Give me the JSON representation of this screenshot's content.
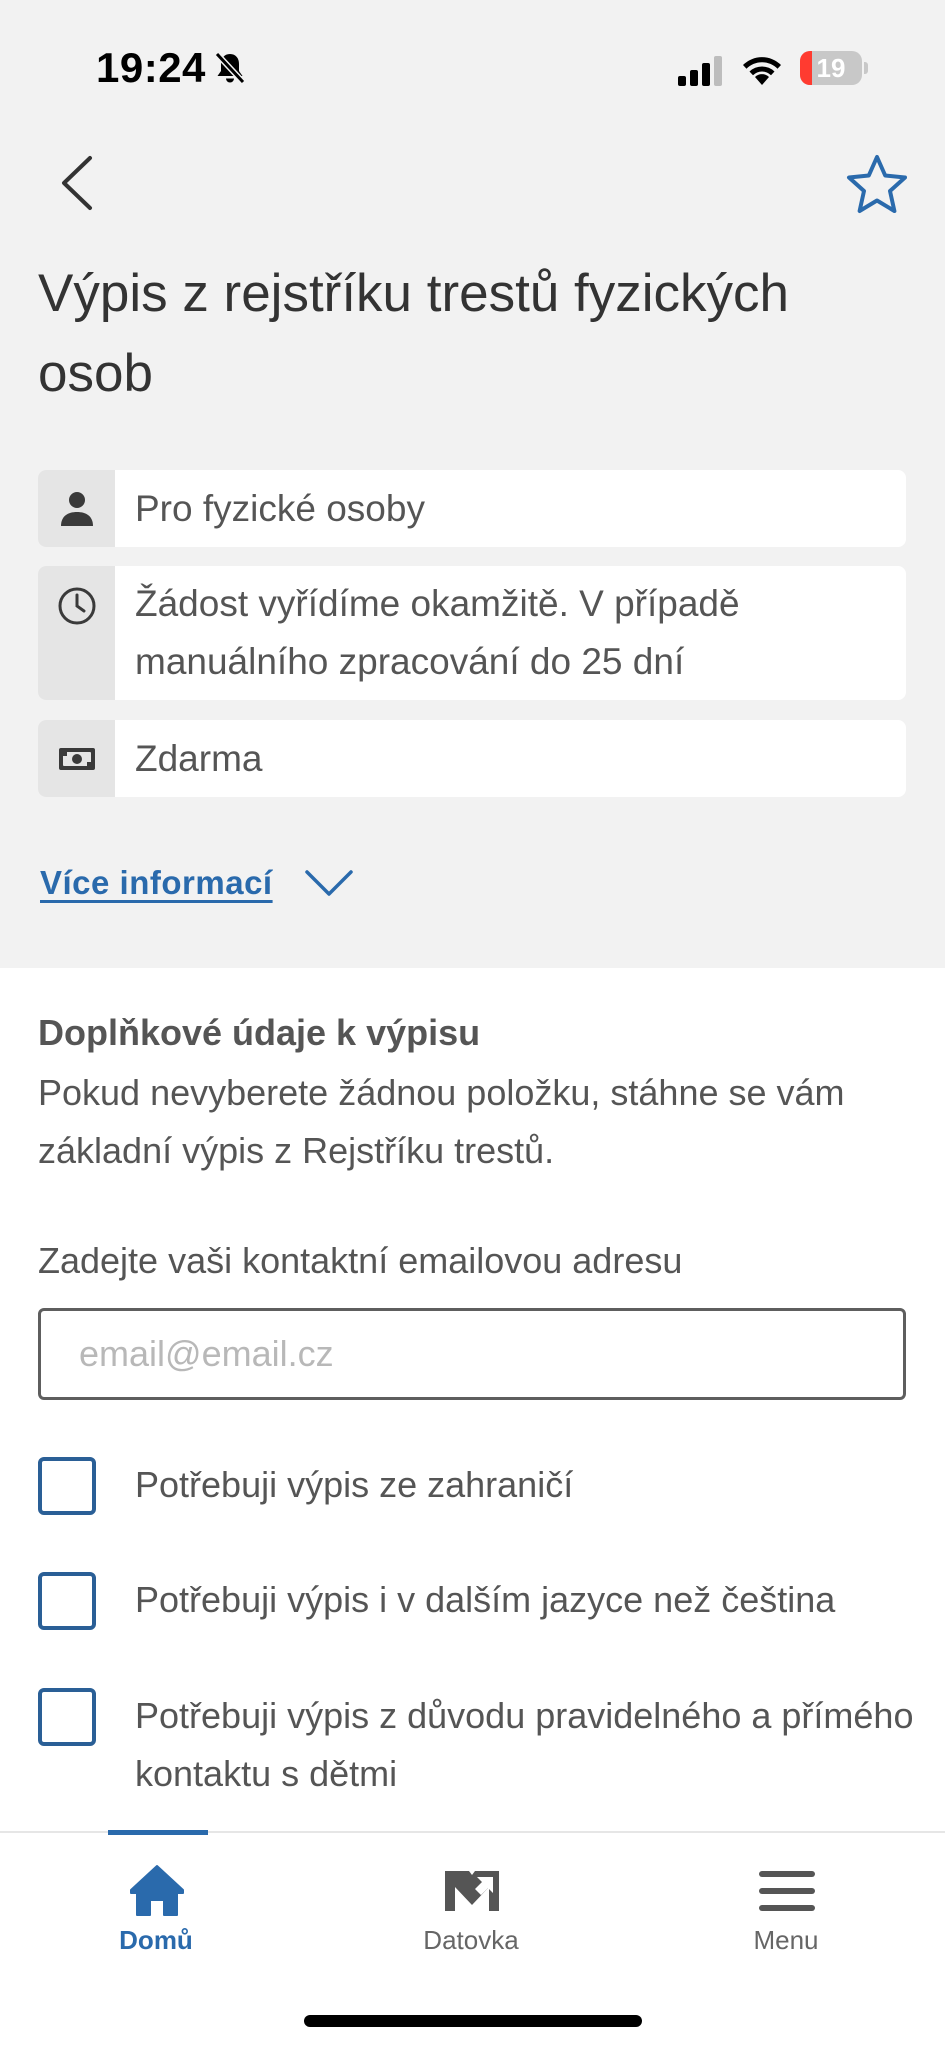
{
  "status_bar": {
    "time": "19:24",
    "battery_level": "19",
    "battery_percent": 19
  },
  "header": {
    "title": "Výpis z rejstříku trestů fyzických osob",
    "back_icon": "chevron-left-icon",
    "favorite_icon": "star-outline-icon"
  },
  "info_cards": [
    {
      "icon": "person-icon",
      "text": "Pro fyzické osoby"
    },
    {
      "icon": "clock-icon",
      "text": "Žádost vyřídíme okamžitě. V případě manuálního zpracování do 25 dní"
    },
    {
      "icon": "banknote-icon",
      "text": "Zdarma"
    }
  ],
  "more_info": {
    "label": "Více informací"
  },
  "form": {
    "section_title": "Doplňkové údaje k výpisu",
    "section_description": "Pokud nevyberete žádnou položku, stáhne se vám základní výpis z Rejstříku trestů.",
    "email_label": "Zadejte vaši kontaktní emailovou adresu",
    "email_placeholder": "email@email.cz",
    "email_value": "",
    "options": [
      {
        "label": "Potřebuji výpis ze zahraničí",
        "checked": false
      },
      {
        "label": "Potřebuji výpis i v dalším jazyce než čeština",
        "checked": false
      },
      {
        "label": "Potřebuji výpis z důvodu pravidelného a přímého kontaktu s dětmi",
        "checked": false
      }
    ]
  },
  "tab_bar": {
    "tabs": [
      {
        "label": "Domů",
        "icon": "home-icon",
        "active": true
      },
      {
        "label": "Datovka",
        "icon": "datovka-icon",
        "active": false
      },
      {
        "label": "Menu",
        "icon": "menu-icon",
        "active": false
      }
    ]
  },
  "colors": {
    "accent": "#2a6aac",
    "checkbox_border": "#2a5f96",
    "background_top": "#f2f2f2",
    "icon_cell": "#e5e5e5",
    "battery_low": "#ff3b30"
  }
}
